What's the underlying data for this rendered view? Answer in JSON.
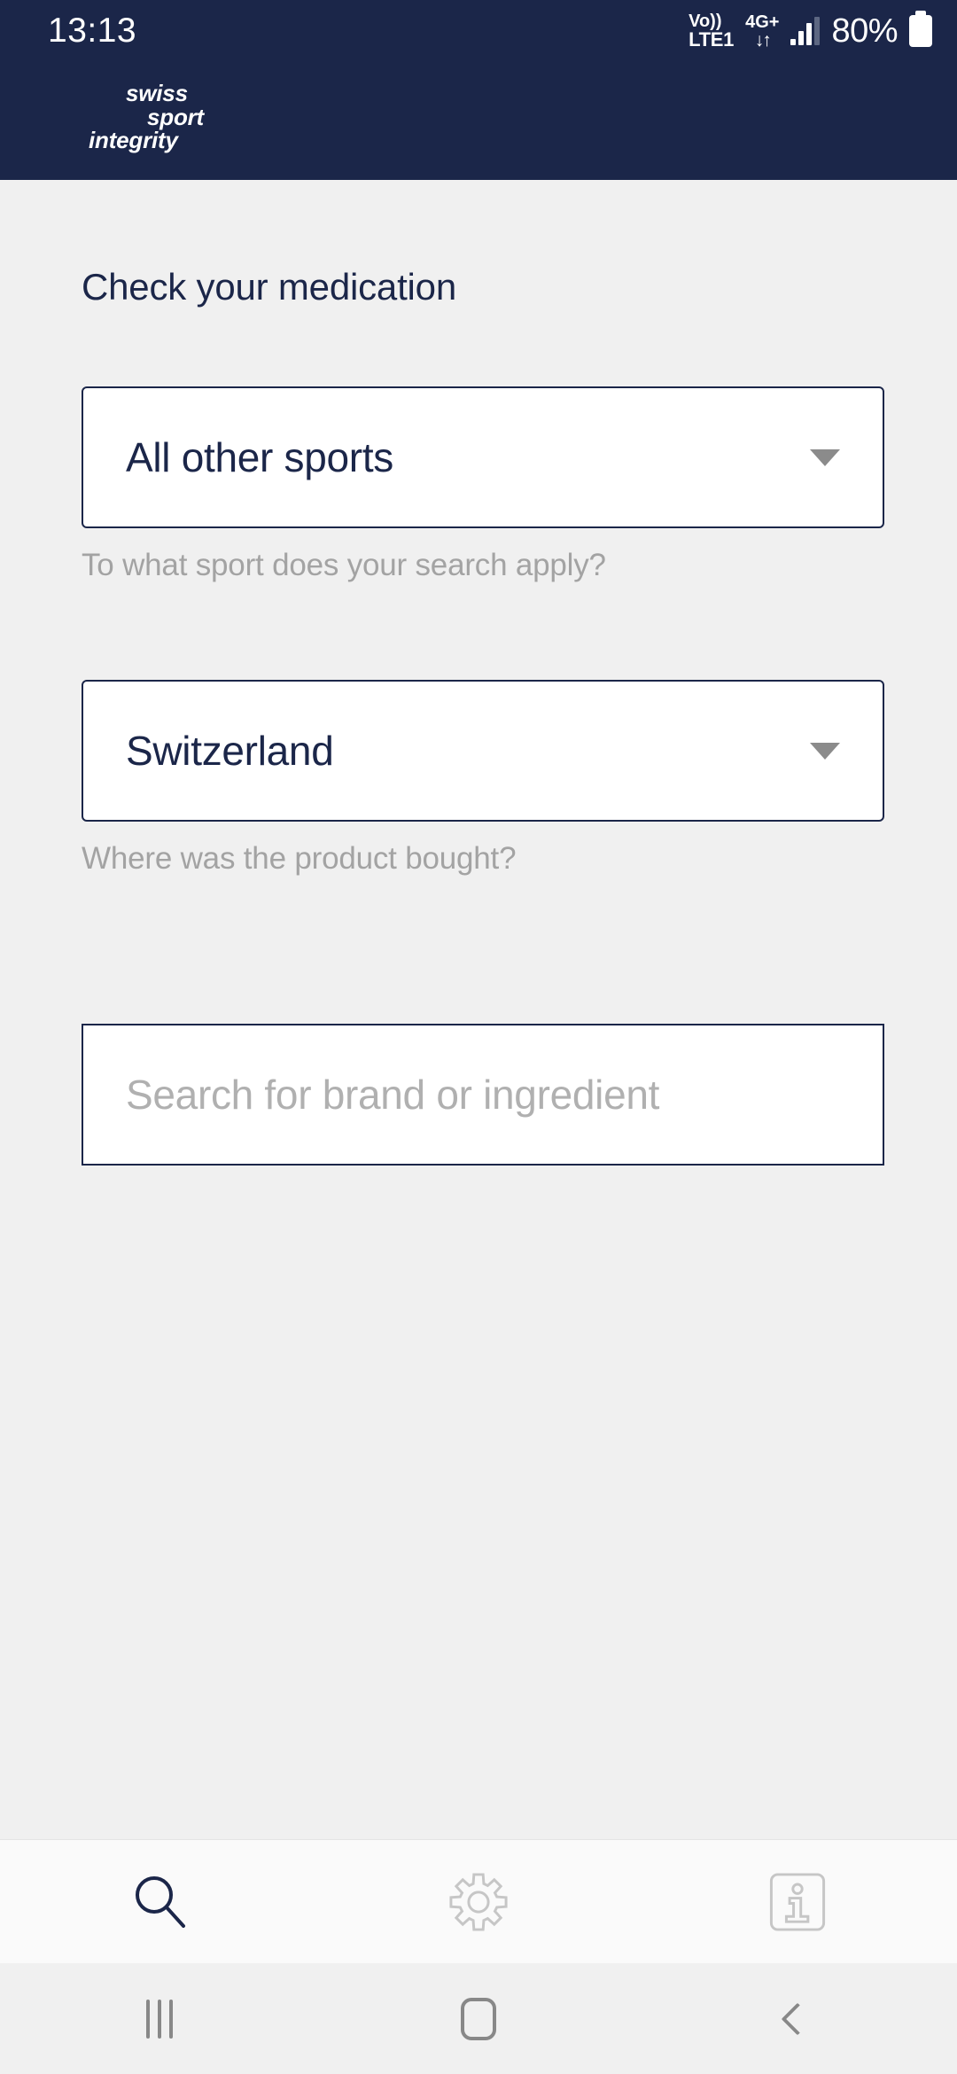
{
  "status_bar": {
    "time": "13:13",
    "volte_line1": "Vo))",
    "volte_line2": "LTE1",
    "network_label": "4G+",
    "data_arrows": "↓↑",
    "signal_icon": "signal-bars-icon",
    "battery_percent": "80%",
    "battery_icon": "battery-full-icon"
  },
  "brand": {
    "line1": "swiss",
    "line2": "sport",
    "line3": "integrity",
    "header_color": "#1b2649"
  },
  "main": {
    "page_title": "Check your medication",
    "sport": {
      "value": "All other sports",
      "helper": "To what sport does your search apply?",
      "chevron_icon": "chevron-down-icon"
    },
    "country": {
      "value": "Switzerland",
      "helper": "Where was the product bought?",
      "chevron_icon": "chevron-down-icon"
    },
    "search": {
      "value": "",
      "placeholder": "Search for brand or ingredient"
    }
  },
  "tab_bar": {
    "tabs": [
      {
        "name": "search",
        "icon": "search-icon",
        "active": true
      },
      {
        "name": "settings",
        "icon": "gear-icon",
        "active": false
      },
      {
        "name": "info",
        "icon": "info-icon",
        "active": false
      }
    ],
    "active_color": "#1b2649",
    "inactive_color": "#c6c6c6"
  },
  "android_nav": {
    "recents_icon": "recents-icon",
    "home_icon": "home-icon",
    "back_icon": "back-icon",
    "color": "#888888"
  }
}
